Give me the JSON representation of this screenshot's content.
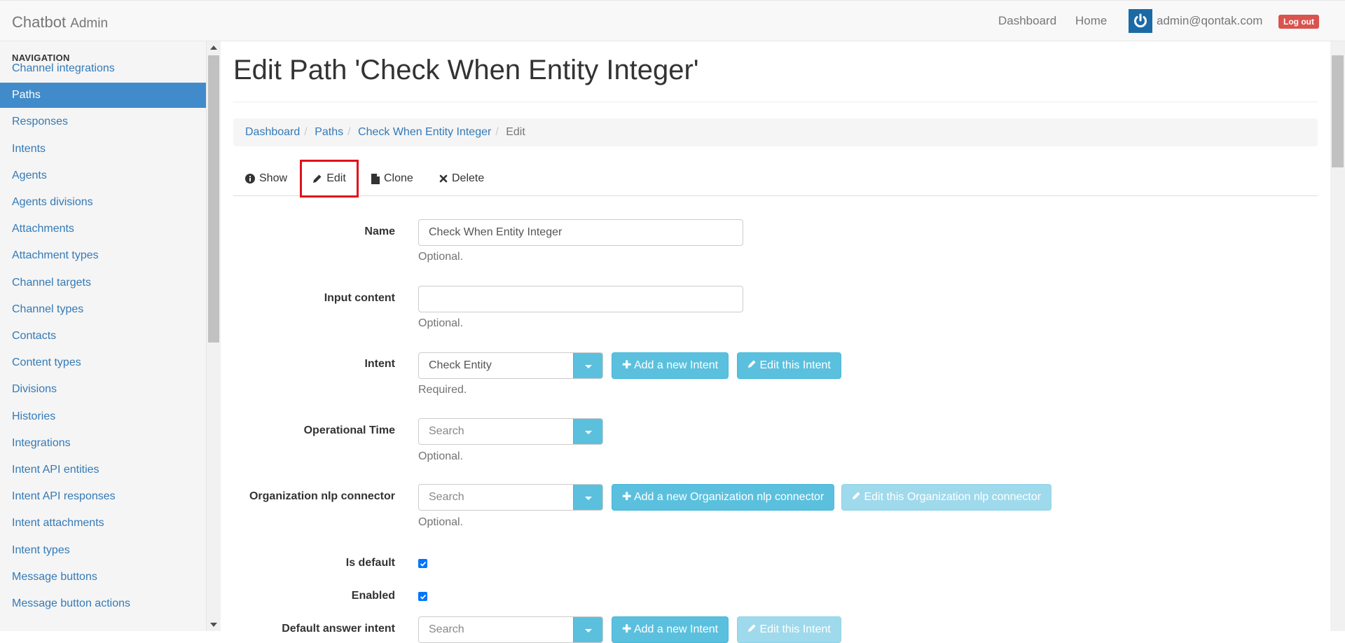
{
  "navbar": {
    "brand": "Chatbot",
    "brand_sub": "Admin",
    "links": [
      "Dashboard",
      "Home"
    ],
    "user_email": "admin@qontak.com",
    "logout_label": "Log out"
  },
  "sidebar": {
    "header": "NAVIGATION",
    "items": [
      "Channel integrations",
      "Paths",
      "Responses",
      "Intents",
      "Agents",
      "Agents divisions",
      "Attachments",
      "Attachment types",
      "Channel targets",
      "Channel types",
      "Contacts",
      "Content types",
      "Divisions",
      "Histories",
      "Integrations",
      "Intent API entities",
      "Intent API responses",
      "Intent attachments",
      "Intent types",
      "Message buttons",
      "Message button actions"
    ],
    "active_index": 1
  },
  "page": {
    "title": "Edit Path 'Check When Entity Integer'",
    "breadcrumb": [
      "Dashboard",
      "Paths",
      "Check When Entity Integer"
    ],
    "breadcrumb_current": "Edit",
    "tabs": [
      "Show",
      "Edit",
      "Clone",
      "Delete"
    ],
    "active_tab": "Edit"
  },
  "form": {
    "name": {
      "label": "Name",
      "value": "Check When Entity Integer",
      "help": "Optional."
    },
    "input_content": {
      "label": "Input content",
      "value": "",
      "help": "Optional."
    },
    "intent": {
      "label": "Intent",
      "value": "Check Entity",
      "help": "Required.",
      "add_label": "Add a new Intent",
      "edit_label": "Edit this Intent"
    },
    "operational_time": {
      "label": "Operational Time",
      "placeholder": "Search",
      "help": "Optional."
    },
    "org_nlp": {
      "label": "Organization nlp connector",
      "placeholder": "Search",
      "help": "Optional.",
      "add_label": "Add a new Organization nlp connector",
      "edit_label": "Edit this Organization nlp connector"
    },
    "is_default": {
      "label": "Is default",
      "checked": true
    },
    "enabled": {
      "label": "Enabled",
      "checked": true
    },
    "default_answer_intent": {
      "label": "Default answer intent",
      "placeholder": "Search",
      "add_label": "Add a new Intent",
      "edit_label": "Edit this Intent"
    }
  },
  "colors": {
    "accent": "#428bca",
    "info": "#5bc0de",
    "danger": "#d9534f",
    "highlight": "#e0121a"
  }
}
